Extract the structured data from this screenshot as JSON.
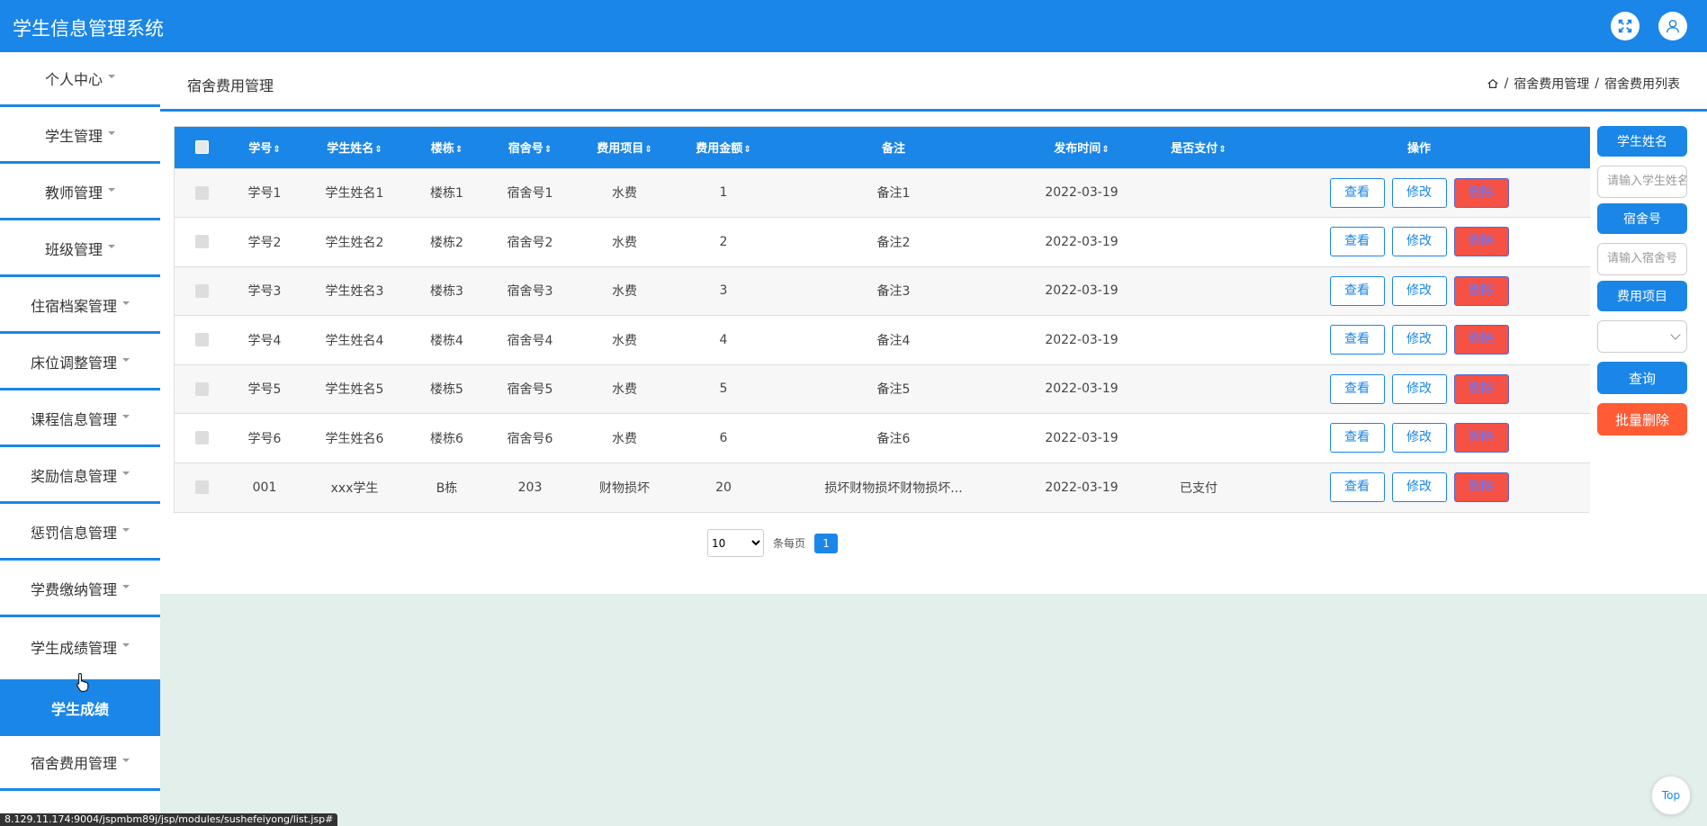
{
  "app": {
    "title": "学生信息管理系统"
  },
  "topbar": {
    "fullscreen_icon": "fullscreen-icon",
    "user_icon": "user-icon"
  },
  "sidebar": {
    "items": [
      {
        "label": "个人中心"
      },
      {
        "label": "学生管理"
      },
      {
        "label": "教师管理"
      },
      {
        "label": "班级管理"
      },
      {
        "label": "住宿档案管理"
      },
      {
        "label": "床位调整管理"
      },
      {
        "label": "课程信息管理"
      },
      {
        "label": "奖励信息管理"
      },
      {
        "label": "惩罚信息管理"
      },
      {
        "label": "学费缴纳管理"
      },
      {
        "label": "学生成绩管理"
      },
      {
        "label": "学生成绩"
      },
      {
        "label": "宿舍费用管理"
      }
    ]
  },
  "header": {
    "title": "宿舍费用管理",
    "breadcrumb": [
      "宿舍费用管理",
      "宿舍费用列表"
    ],
    "separator": "/"
  },
  "table": {
    "columns": [
      "学号",
      "学生姓名",
      "楼栋",
      "宿舍号",
      "费用项目",
      "费用金额",
      "备注",
      "发布时间",
      "是否支付",
      "操作"
    ],
    "sortable_marker": "⇕",
    "rows": [
      {
        "xuehao": "学号1",
        "name": "学生姓名1",
        "building": "楼栋1",
        "room": "宿舍号1",
        "item": "水费",
        "amount": "1",
        "note": "备注1",
        "time": "2022-03-19",
        "paid": ""
      },
      {
        "xuehao": "学号2",
        "name": "学生姓名2",
        "building": "楼栋2",
        "room": "宿舍号2",
        "item": "水费",
        "amount": "2",
        "note": "备注2",
        "time": "2022-03-19",
        "paid": ""
      },
      {
        "xuehao": "学号3",
        "name": "学生姓名3",
        "building": "楼栋3",
        "room": "宿舍号3",
        "item": "水费",
        "amount": "3",
        "note": "备注3",
        "time": "2022-03-19",
        "paid": ""
      },
      {
        "xuehao": "学号4",
        "name": "学生姓名4",
        "building": "楼栋4",
        "room": "宿舍号4",
        "item": "水费",
        "amount": "4",
        "note": "备注4",
        "time": "2022-03-19",
        "paid": ""
      },
      {
        "xuehao": "学号5",
        "name": "学生姓名5",
        "building": "楼栋5",
        "room": "宿舍号5",
        "item": "水费",
        "amount": "5",
        "note": "备注5",
        "time": "2022-03-19",
        "paid": ""
      },
      {
        "xuehao": "学号6",
        "name": "学生姓名6",
        "building": "楼栋6",
        "room": "宿舍号6",
        "item": "水费",
        "amount": "6",
        "note": "备注6",
        "time": "2022-03-19",
        "paid": ""
      },
      {
        "xuehao": "001",
        "name": "xxx学生",
        "building": "B栋",
        "room": "203",
        "item": "财物损坏",
        "amount": "20",
        "note": "损坏财物损坏财物损坏...",
        "time": "2022-03-19",
        "paid": "已支付"
      }
    ],
    "actions": {
      "view": "查看",
      "edit": "修改",
      "delete": "删除"
    }
  },
  "pagination": {
    "page_size": "10",
    "per_page_label": "条每页",
    "current_page": "1"
  },
  "search_panel": {
    "name_label": "学生姓名",
    "name_placeholder": "请输入学生姓名",
    "room_label": "宿舍号",
    "room_placeholder": "请输入宿舍号",
    "item_label": "费用项目",
    "query_button": "查询",
    "batch_delete_button": "批量删除"
  },
  "back_to_top": "Top",
  "status_bar_url": "8.129.11.174:9004/jspmbm89j/jsp/modules/sushefeiyong/list.jsp#",
  "colors": {
    "primary": "#1a86e8",
    "danger": "#f55145",
    "batch_delete": "#ff5b35",
    "page_bg_lower": "#e2efea"
  }
}
